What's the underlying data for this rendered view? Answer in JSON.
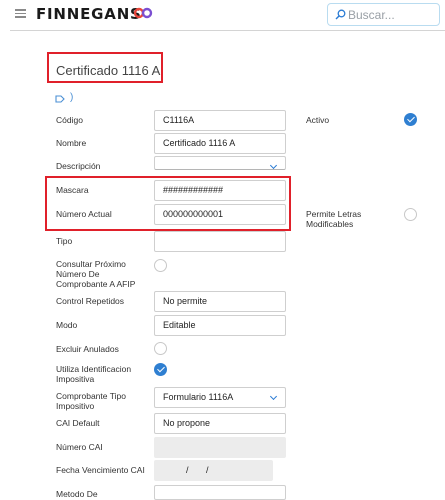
{
  "brand": {
    "name": "FINNEGANS",
    "accent_colors": [
      "#e8473c",
      "#7b4fd1"
    ]
  },
  "search": {
    "placeholder": "Buscar..."
  },
  "page": {
    "title": "Certificado 1116 A",
    "nav_arrow": ")"
  },
  "colors": {
    "highlight": "#e0202a",
    "check": "#2f7fd1",
    "disabled_field": "#ececec"
  },
  "fields": {
    "codigo": {
      "label": "Código",
      "value": "C1116A"
    },
    "nombre": {
      "label": "Nombre",
      "value": "Certificado 1116 A"
    },
    "descripcion": {
      "label": "Descripción",
      "value": ""
    },
    "mascara": {
      "label": "Mascara",
      "value": "############"
    },
    "numero_actual": {
      "label": "Número Actual",
      "value": "000000000001"
    },
    "tipo": {
      "label": "Tipo",
      "value": ""
    },
    "consultar": {
      "label_lines": [
        "Consultar Próximo",
        "Número De",
        "Comprobante A AFIP"
      ],
      "checked": false
    },
    "control_repetidos": {
      "label": "Control Repetidos",
      "value": "No permite"
    },
    "modo": {
      "label": "Modo",
      "value": "Editable"
    },
    "excluir_anulados": {
      "label": "Excluir Anulados",
      "checked": false
    },
    "utiliza_identificacion": {
      "label_lines": [
        "Utiliza Identificacion",
        "Impositiva"
      ],
      "checked": true
    },
    "comprobante_tipo": {
      "label_lines": [
        "Comprobante Tipo",
        "Impositivo"
      ],
      "value": "Formulario 1116A"
    },
    "cai_default": {
      "label": "CAI Default",
      "value": "No propone"
    },
    "numero_cai": {
      "label": "Número CAI",
      "value": ""
    },
    "fecha_vencimiento_cai": {
      "label": "Fecha Vencimiento CAI",
      "value": "  /       /"
    },
    "metodo_de": {
      "label": "Metodo De",
      "value": ""
    },
    "activo": {
      "label": "Activo",
      "checked": true
    },
    "permite_letras": {
      "label_lines": [
        "Permite Letras",
        "Modificables"
      ],
      "checked": false
    }
  }
}
